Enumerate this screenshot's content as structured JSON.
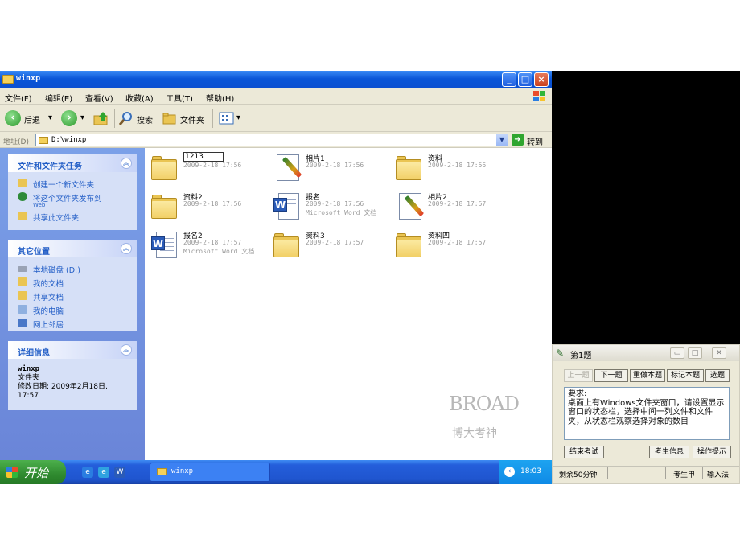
{
  "explorer": {
    "title": "winxp",
    "menu": [
      "文件(F)",
      "编辑(E)",
      "查看(V)",
      "收藏(A)",
      "工具(T)",
      "帮助(H)"
    ],
    "toolbar": {
      "back": "后退",
      "search": "搜索",
      "folders": "文件夹"
    },
    "address": {
      "label": "地址(D)",
      "value": "D:\\winxp",
      "go": "转到"
    }
  },
  "taskpane": {
    "tasks": {
      "title": "文件和文件夹任务",
      "items": [
        {
          "label": "创建一个新文件夹",
          "sub": ""
        },
        {
          "label": "将这个文件夹发布到",
          "sub": "Web"
        },
        {
          "label": "共享此文件夹",
          "sub": ""
        }
      ]
    },
    "places": {
      "title": "其它位置",
      "items": [
        "本地磁盘 (D:)",
        "我的文档",
        "共享文档",
        "我的电脑",
        "网上邻居"
      ]
    },
    "details": {
      "title": "详细信息",
      "name": "winxp",
      "type": "文件夹",
      "modified": "修改日期: 2009年2月18日, 17:57"
    }
  },
  "files": [
    {
      "name": "1213",
      "line1": "2009-2-18 17:56",
      "line2": "",
      "kind": "folder"
    },
    {
      "name": "相片1",
      "line1": "2009-2-18 17:56",
      "line2": "",
      "kind": "picture"
    },
    {
      "name": "资料",
      "line1": "2009-2-18 17:56",
      "line2": "",
      "kind": "folder"
    },
    {
      "name": "资料2",
      "line1": "2009-2-18 17:56",
      "line2": "",
      "kind": "folder"
    },
    {
      "name": "报名",
      "line1": "2009-2-18 17:56",
      "line2": "Microsoft Word 文档",
      "kind": "word"
    },
    {
      "name": "相片2",
      "line1": "2009-2-18 17:57",
      "line2": "",
      "kind": "picture"
    },
    {
      "name": "报名2",
      "line1": "2009-2-18 17:57",
      "line2": "Microsoft Word 文档",
      "kind": "word"
    },
    {
      "name": "资料3",
      "line1": "2009-2-18 17:57",
      "line2": "",
      "kind": "folder"
    },
    {
      "name": "资料四",
      "line1": "2009-2-18 17:57",
      "line2": "",
      "kind": "folder"
    }
  ],
  "watermark": {
    "top": "BROAD",
    "bottom": "博大考神"
  },
  "taskbar": {
    "start": "开始",
    "task": "winxp",
    "clock": "18:03"
  },
  "exam": {
    "title": "第1题",
    "buttons": [
      "上一题",
      "下一题",
      "重做本题",
      "标记本题",
      "选题"
    ],
    "requirement": "要求:\n桌面上有Windows文件夹窗口，请设置显示窗口的状态栏，选择中间一列文件和文件夹，从状态栏观察选择对象的数目",
    "actions": {
      "end": "结束考试",
      "info": "考生信息",
      "hint": "操作提示"
    },
    "status": {
      "time": "剩余50分钟",
      "user": "考生甲",
      "ime": "输入法"
    }
  },
  "colors": {
    "xp_blue": "#0a56d8",
    "pane_blue": "#7ba0e8",
    "link_blue": "#215dc6"
  }
}
